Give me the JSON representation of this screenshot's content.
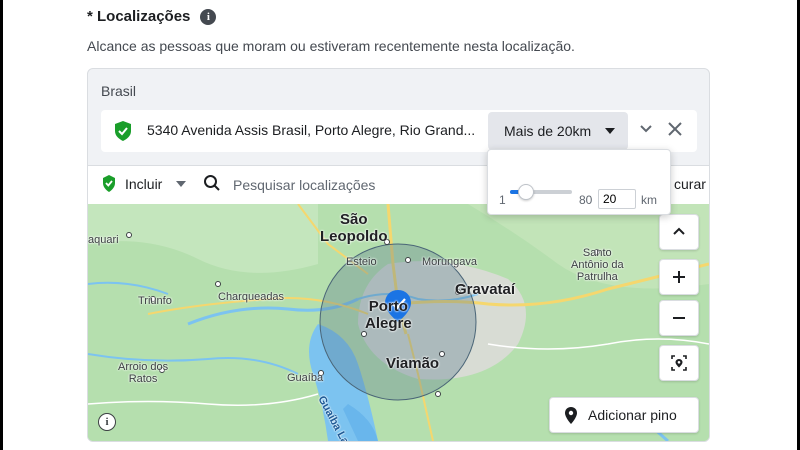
{
  "heading": {
    "label": "* Localizações",
    "info_icon": "i"
  },
  "description": "Alcance as pessoas que moram ou estiveram recentemente nesta localização.",
  "card": {
    "country": "Brasil",
    "location": {
      "address": "5340 Avenida Assis Brasil, Porto Alegre, Rio Grand...",
      "radius_label": "Mais de 20km",
      "pin_color": "#1a9e2a"
    },
    "search": {
      "include_label": "Incluir",
      "placeholder": "Pesquisar localizações",
      "trailing_text": "curar"
    },
    "radius_popover": {
      "min": "1",
      "max": "80",
      "value": "20",
      "unit": "km",
      "slider_fraction": 0.24
    },
    "map": {
      "labels": {
        "sao_leopoldo": "São\nLeopoldo",
        "esteio": "Esteio",
        "morungava": "Morungava",
        "gravatai": "Gravataí",
        "porto_alegre": "Porto\nAlegre",
        "viamao": "Viamão",
        "charqueadas": "Charqueadas",
        "triunfo": "Triunfo",
        "arroio_dos_ratos": "Arroio dos\nRatos",
        "guaiba": "Guaíba",
        "guaiba_lake": "Guaíba La",
        "santo_antonio": "Santo\nAntônio da\nPatrulha",
        "aquari": "aquari"
      },
      "add_pin_label": "Adicionar pino",
      "info_icon": "i"
    }
  }
}
